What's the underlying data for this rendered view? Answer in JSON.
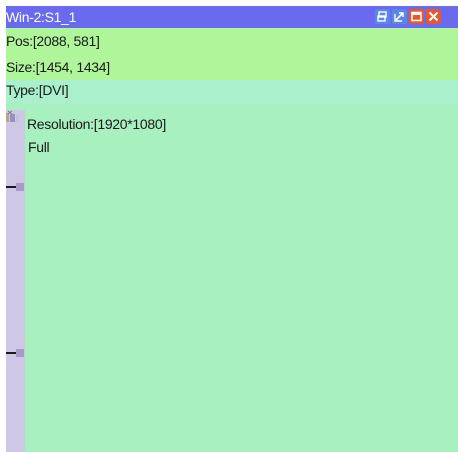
{
  "window": {
    "title": "Win-2:S1_1",
    "controls": {
      "restore_icon": "restore-icon",
      "maximize_icon": "maximize-icon",
      "window_icon": "window-icon",
      "close_icon": "close-icon"
    }
  },
  "info": {
    "pos": "Pos:[2088, 581]",
    "size": "Size:[1454, 1434]",
    "type": "Type:[DVI]"
  },
  "content": {
    "resolution": "Resolution:[1920*1080]",
    "mode": "Full"
  },
  "colors": {
    "titlebar": "#6a6aee",
    "background": "#a8f0c0",
    "info_rows": "#aff59a",
    "type_row": "#aaf0cc",
    "scrollbar": "#cec8e6",
    "close_button": "#e7572c",
    "blue_button": "#5a88e8"
  }
}
